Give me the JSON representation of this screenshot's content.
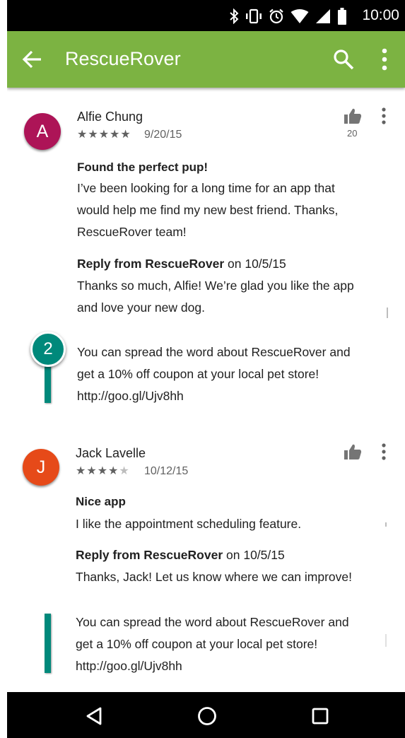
{
  "status_bar": {
    "time": "10:00",
    "icons": [
      "bluetooth-icon",
      "vibrate-icon",
      "alarm-icon",
      "wifi-icon",
      "signal-icon",
      "battery-icon"
    ]
  },
  "app_bar": {
    "title": "RescueRover",
    "color": "#7cb342",
    "icons": [
      "back-arrow-icon",
      "search-icon",
      "overflow-menu-icon"
    ]
  },
  "reviews": [
    {
      "avatar_letter": "A",
      "avatar_color": "#ad1457",
      "name": "Alfie Chung",
      "rating": 5,
      "stars": "★★★★★",
      "date": "9/20/15",
      "likes": "20",
      "title": "Found the perfect pup!",
      "body": "I’ve been looking for a long time for an app that\nwould help me find my new best friend. Thanks,\nRescueRover team!",
      "reply": {
        "from_label": "Reply from RescueRover",
        "date_text": " on 10/5/15",
        "text": "Thanks so much, Alfie! We’re glad you like the app\nand love your new dog.",
        "extra": "You can spread the word about RescueRover and\nget a 10% off coupon at your local pet store!\nhttp://goo.gl/Ujv8hh"
      }
    },
    {
      "avatar_letter": "J",
      "avatar_color": "#e64a19",
      "name": "Jack Lavelle",
      "rating": 4,
      "stars": "★★★★",
      "empty_star": "★",
      "date": "10/12/15",
      "likes": "",
      "title": "Nice app",
      "body": "I like the appointment scheduling feature.",
      "reply": {
        "from_label": "Reply from RescueRover",
        "date_text": " on 10/5/15",
        "text": "Thanks, Jack! Let us know where we can improve!",
        "extra": "You can spread the word about RescueRover and\nget a 10% off coupon at your local pet store!\nhttp://goo.gl/Ujv8hh"
      }
    }
  ],
  "annotation": {
    "marker_label": "2",
    "color": "#00897b"
  },
  "nav_bar": {
    "icons": [
      "back-triangle-icon",
      "home-circle-icon",
      "recents-square-icon"
    ]
  }
}
